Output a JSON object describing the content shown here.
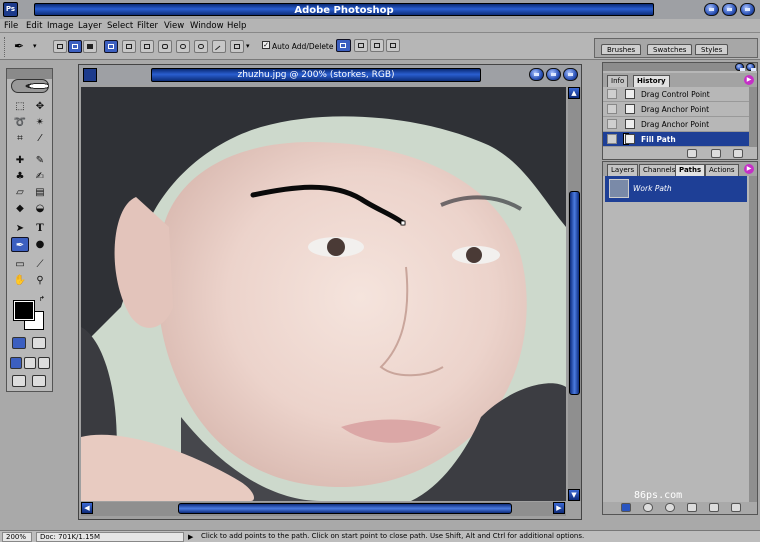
{
  "app": {
    "title": "Adobe Photoshop",
    "icon_label": "Ps"
  },
  "menu": [
    "File",
    "Edit",
    "Image",
    "Layer",
    "Select",
    "Filter",
    "View",
    "Window",
    "Help"
  ],
  "options_bar": {
    "auto_add_delete_label": "Auto Add/Delete",
    "auto_add_delete_checked": true
  },
  "palette_well": {
    "tabs": [
      "Brushes",
      "Swatches",
      "Styles"
    ]
  },
  "document": {
    "title": "zhuzhu.jpg @ 200% (storkes, RGB)"
  },
  "history_panel": {
    "tabs": [
      "Info",
      "History"
    ],
    "items": [
      {
        "label": "Drag Control Point"
      },
      {
        "label": "Drag Anchor Point"
      },
      {
        "label": "Drag Anchor Point"
      },
      {
        "label": "Fill Path"
      }
    ],
    "selected_index": 3
  },
  "paths_panel": {
    "tabs": [
      "Layers",
      "Channels",
      "Paths",
      "Actions"
    ],
    "paths": [
      "Work Path"
    ]
  },
  "status_bar": {
    "zoom": "200%",
    "doc_size": "Doc: 701K/1.15M",
    "hint": "Click to add points to the path.  Click on start point to close path.  Use Shift, Alt and Ctrl for additional options."
  },
  "watermark": "86ps.com",
  "colors": {
    "title_blue": "#1e4bb8",
    "selection_blue": "#1e3f96",
    "foreground": "#000000",
    "background": "#ffffff"
  },
  "icons": [
    "eye-logo",
    "pen-tool",
    "path-stroke",
    "fill-path"
  ]
}
